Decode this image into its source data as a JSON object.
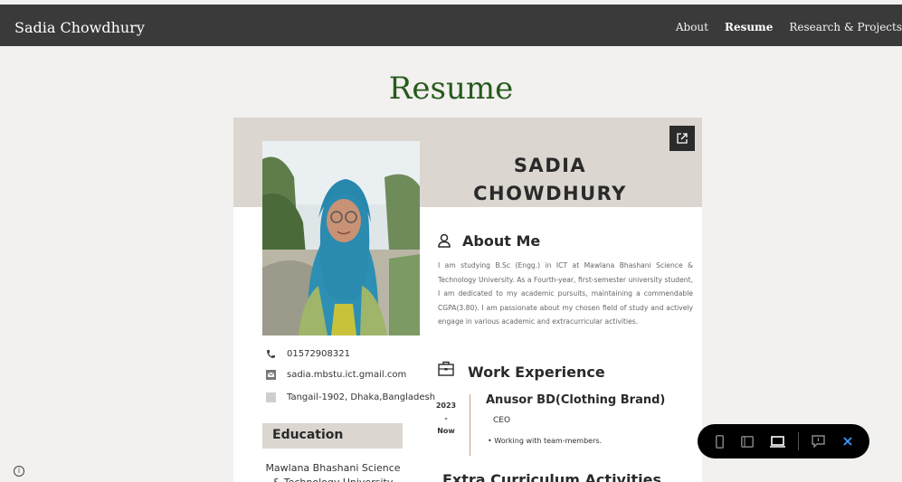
{
  "header": {
    "brand": "Sadia Chowdhury",
    "nav": [
      {
        "label": "About",
        "active": false
      },
      {
        "label": "Resume",
        "active": true
      },
      {
        "label": "Research & Projects",
        "active": false
      }
    ]
  },
  "page": {
    "title": "Resume"
  },
  "resume": {
    "first_name": "SADIA",
    "last_name": "CHOWDHURY",
    "contact": {
      "phone": "01572908321",
      "email": "sadia.mbstu.ict.gmail.com",
      "address": "Tangail-1902, Dhaka,Bangladesh"
    },
    "education": {
      "heading": "Education",
      "institution": "Mawlana Bhashani Science & Technology University"
    },
    "about": {
      "heading": "About Me",
      "text": "I am studying B.Sc (Engg.) in ICT at Mawlana Bhashani Science & Technology University. As a Fourth-year, first-semester university student, I am dedicated to my academic pursuits, maintaining a commendable CGPA(3.80). I am passionate about my chosen field of study and actively engage in various academic and extracurricular activities."
    },
    "work": {
      "heading": "Work Experience",
      "date_start": "2023",
      "date_sep": "-",
      "date_end": "Now",
      "company": "Anusor BD(Clothing Brand)",
      "role": "CEO",
      "bullet": "Working with team-members."
    },
    "extra_heading": "Extra Curriculum Activities"
  },
  "icons": {
    "open_external": "external-link-icon",
    "phone": "phone-icon",
    "email": "mail-icon",
    "address": "location-icon",
    "about": "user-icon",
    "work": "briefcase-icon",
    "info": "info-icon"
  },
  "toolbar": {
    "buttons": [
      "mobile-view-icon",
      "tablet-view-icon",
      "laptop-view-icon",
      "comment-icon",
      "close-icon"
    ]
  },
  "colors": {
    "title_green": "#275a1c",
    "band": "#dcd6d1",
    "topbar": "#3a3a3a",
    "timeline": "#cf9b85",
    "close_blue": "#3b9bff"
  }
}
